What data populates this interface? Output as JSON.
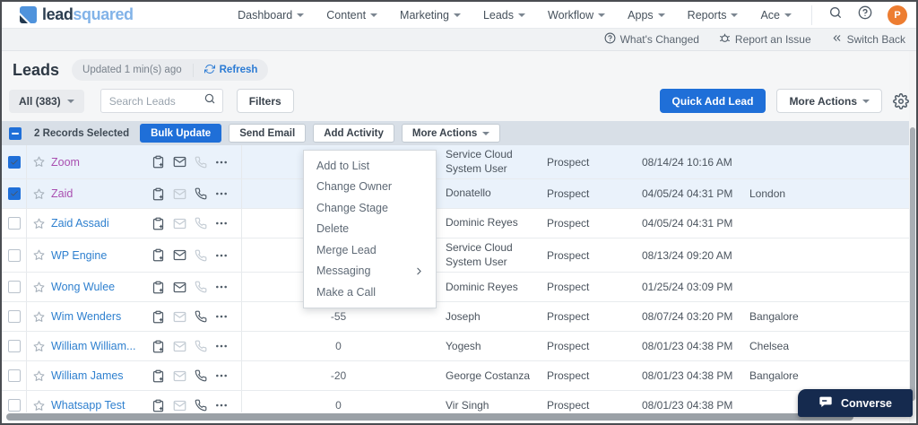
{
  "topnav": {
    "logo_lead": "lead",
    "logo_squared": "squared",
    "items": [
      "Dashboard",
      "Content",
      "Marketing",
      "Leads",
      "Workflow",
      "Apps",
      "Reports",
      "Ace"
    ],
    "avatar_initial": "P"
  },
  "utility_bar": {
    "whats_changed": "What's Changed",
    "report_issue": "Report an Issue",
    "switch_back": "Switch Back"
  },
  "page_header": {
    "title": "Leads",
    "updated_text": "Updated 1 min(s) ago",
    "refresh_label": "Refresh",
    "view_filter": "All (383)",
    "search_placeholder": "Search Leads",
    "filters_label": "Filters",
    "quick_add_label": "Quick Add Lead",
    "more_actions_label": "More Actions"
  },
  "toolbar": {
    "selected_text": "2 Records Selected",
    "bulk_update": "Bulk Update",
    "send_email": "Send Email",
    "add_activity": "Add Activity",
    "more_actions": "More Actions"
  },
  "dropdown_menu": {
    "items": [
      {
        "label": "Add to List",
        "has_submenu": false
      },
      {
        "label": "Change Owner",
        "has_submenu": false
      },
      {
        "label": "Change Stage",
        "has_submenu": false
      },
      {
        "label": "Delete",
        "has_submenu": false
      },
      {
        "label": "Merge Lead",
        "has_submenu": false
      },
      {
        "label": "Messaging",
        "has_submenu": true
      },
      {
        "label": "Make a Call",
        "has_submenu": false
      }
    ]
  },
  "table": {
    "rows": [
      {
        "name": "Zoom",
        "checked": true,
        "visited": true,
        "email_active": true,
        "phone_active": false,
        "score": "",
        "owner": "Service Cloud System User",
        "stage": "Prospect",
        "modified": "08/14/24 10:16 AM",
        "city": ""
      },
      {
        "name": "Zaid",
        "checked": true,
        "visited": true,
        "email_active": false,
        "phone_active": true,
        "score": "",
        "owner": "Donatello",
        "stage": "Prospect",
        "modified": "04/05/24 04:31 PM",
        "city": "London"
      },
      {
        "name": "Zaid Assadi",
        "checked": false,
        "visited": false,
        "email_active": false,
        "phone_active": false,
        "score": "",
        "owner": "Dominic Reyes",
        "stage": "Prospect",
        "modified": "04/05/24 04:31 PM",
        "city": ""
      },
      {
        "name": "WP Engine",
        "checked": false,
        "visited": false,
        "email_active": true,
        "phone_active": false,
        "score": "",
        "owner": "Service Cloud System User",
        "stage": "Prospect",
        "modified": "08/13/24 09:20 AM",
        "city": ""
      },
      {
        "name": "Wong Wulee",
        "checked": false,
        "visited": false,
        "email_active": true,
        "phone_active": false,
        "score": "",
        "owner": "Dominic Reyes",
        "stage": "Prospect",
        "modified": "01/25/24 03:09 PM",
        "city": ""
      },
      {
        "name": "Wim Wenders",
        "checked": false,
        "visited": false,
        "email_active": false,
        "phone_active": true,
        "score": "-55",
        "owner": "Joseph",
        "stage": "Prospect",
        "modified": "08/07/24 03:20 PM",
        "city": "Bangalore"
      },
      {
        "name": "William William...",
        "checked": false,
        "visited": false,
        "email_active": false,
        "phone_active": false,
        "score": "0",
        "owner": "Yogesh",
        "stage": "Prospect",
        "modified": "08/01/23 04:38 PM",
        "city": "Chelsea"
      },
      {
        "name": "William James",
        "checked": false,
        "visited": false,
        "email_active": false,
        "phone_active": true,
        "score": "-20",
        "owner": "George Costanza",
        "stage": "Prospect",
        "modified": "08/01/23 04:38 PM",
        "city": "Bangalore"
      },
      {
        "name": "Whatsapp Test",
        "checked": false,
        "visited": false,
        "email_active": false,
        "phone_active": true,
        "score": "0",
        "owner": "Vir Singh",
        "stage": "Prospect",
        "modified": "08/01/23 04:38 PM",
        "city": ""
      }
    ]
  },
  "converse": {
    "label": "Converse"
  },
  "colors": {
    "primary_blue": "#1f6fd8",
    "link_blue": "#2f80cf",
    "visited_purple": "#a94fb0",
    "selected_row_bg": "#eaf2fb",
    "toolbar_bg": "#d8dfe7",
    "avatar_orange": "#ed7d31",
    "converse_navy": "#152a4e"
  }
}
